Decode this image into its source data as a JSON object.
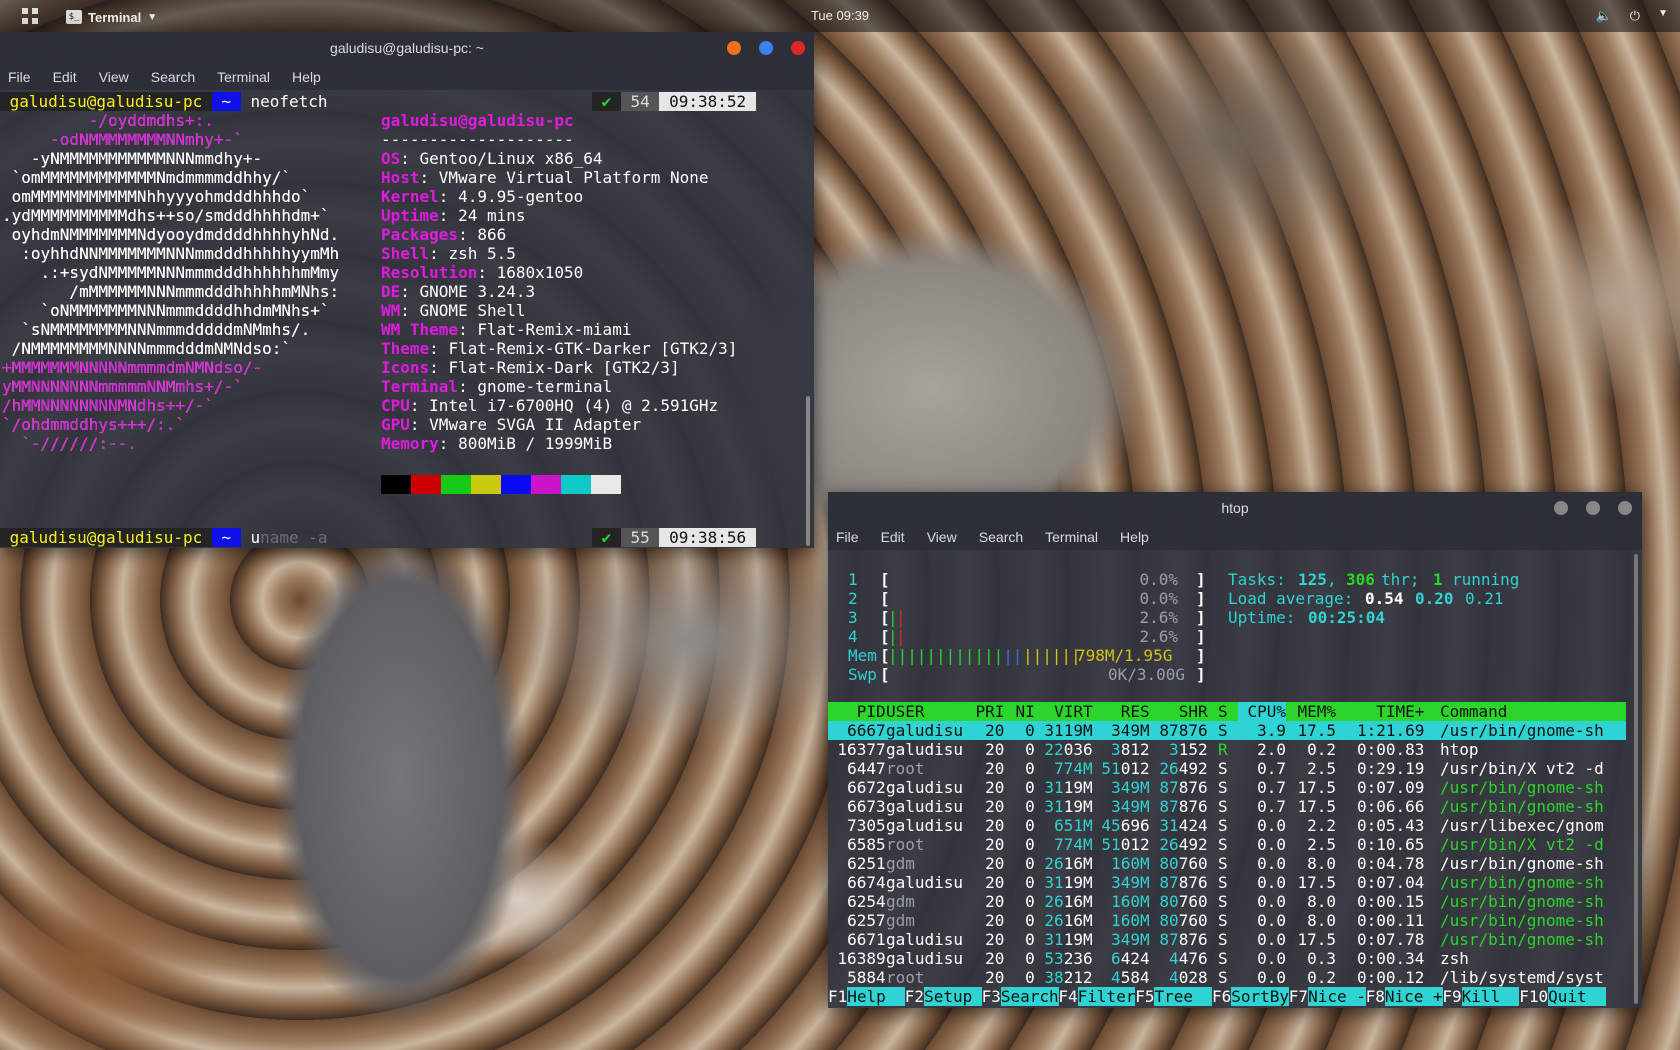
{
  "topbar": {
    "activities_icon": "grid-icon",
    "app_name": "Terminal",
    "clock": "Tue 09:39",
    "tray": [
      "speaker-icon",
      "power-icon",
      "chevron-down-icon"
    ]
  },
  "term1": {
    "title": "galudisu@galudisu-pc: ~",
    "menu": [
      "File",
      "Edit",
      "View",
      "Search",
      "Terminal",
      "Help"
    ],
    "prompt1": {
      "user": "galudisu@galudisu-pc",
      "dir": "~",
      "cmd": "neofetch",
      "check": "✔",
      "num": "54",
      "time": "09:38:52"
    },
    "prompt2": {
      "user": "galudisu@galudisu-pc",
      "dir": "~",
      "cmd_typed": "u",
      "cmd_suggest": "name -a",
      "check": "✔",
      "num": "55",
      "time": "09:38:56"
    },
    "logo": [
      "         -/oyddmdhs+:.",
      "     -odNMMMMMMMMNNmhy+-`",
      "   -yNMMMMMMMMMMMNNNmmdhy+-",
      " `omMMMMMMMMMMMMNmdmmmmddhhy/`",
      " omMMMMMMMMMMMNhhyyyohmdddhhhdo`",
      ".ydMMMMMMMMMMdhs++so/smdddhhhhdm+`",
      " oyhdmNMMMMMMMNdyooydmddddhhhhyhNd.",
      "  :oyhhdNNMMMMMMMNNNmmdddhhhhhyymMh",
      "    .:+sydNMMMMMNNNmmmdddhhhhhhmMmy",
      "       /mMMMMMMNNNmmmdddhhhhhmMNhs:",
      "    `oNMMMMMMMNNNmmmddddhhdmMNhs+`",
      "  `sNMMMMMMMMNNNmmmdddddmNMmhs/.",
      " /NMMMMMMMMNNNNmmmdddmNMNdso:`",
      "+MMMMMMMNNNNNmmmmdmNMNdso/-",
      "yMMNNNNNNNmmmmmNNMmhs+/-`",
      "/hMMNNNNNNNNMNdhs++/-`",
      "`/ohdmmddhys+++/:.`",
      "  `-//////:--."
    ],
    "info_title": "galudisu@galudisu-pc",
    "separator": "--------------------",
    "info": [
      {
        "k": "OS",
        "v": "Gentoo/Linux x86_64"
      },
      {
        "k": "Host",
        "v": "VMware Virtual Platform None"
      },
      {
        "k": "Kernel",
        "v": "4.9.95-gentoo"
      },
      {
        "k": "Uptime",
        "v": "24 mins"
      },
      {
        "k": "Packages",
        "v": "866"
      },
      {
        "k": "Shell",
        "v": "zsh 5.5"
      },
      {
        "k": "Resolution",
        "v": "1680x1050"
      },
      {
        "k": "DE",
        "v": "GNOME 3.24.3"
      },
      {
        "k": "WM",
        "v": "GNOME Shell"
      },
      {
        "k": "WM Theme",
        "v": "Flat-Remix-miami"
      },
      {
        "k": "Theme",
        "v": "Flat-Remix-GTK-Darker [GTK2/3]"
      },
      {
        "k": "Icons",
        "v": "Flat-Remix-Dark [GTK2/3]"
      },
      {
        "k": "Terminal",
        "v": "gnome-terminal"
      },
      {
        "k": "CPU",
        "v": "Intel i7-6700HQ (4) @ 2.591GHz"
      },
      {
        "k": "GPU",
        "v": "VMware SVGA II Adapter"
      },
      {
        "k": "Memory",
        "v": "800MiB / 1999MiB"
      }
    ],
    "palette": [
      "#000000",
      "#cc0000",
      "#17c917",
      "#c9c90f",
      "#0a0af0",
      "#c914c9",
      "#0fc9c9",
      "#e8e8e8"
    ]
  },
  "term2": {
    "title": "htop",
    "menu": [
      "File",
      "Edit",
      "View",
      "Search",
      "Terminal",
      "Help"
    ],
    "cpu": [
      {
        "n": "1",
        "pct": "0.0%"
      },
      {
        "n": "2",
        "pct": "0.0%"
      },
      {
        "n": "3",
        "pct": "2.6%"
      },
      {
        "n": "4",
        "pct": "2.6%"
      }
    ],
    "mem": {
      "label": "Mem",
      "value": "798M/1.95G"
    },
    "swp": {
      "label": "Swp",
      "value": "0K/3.00G"
    },
    "tasks": {
      "label": "Tasks:",
      "tasks": "125",
      "thr": "306",
      "thr_label": "thr;",
      "running": "1",
      "running_label": "running"
    },
    "load": {
      "label": "Load average:",
      "a": "0.54",
      "b": "0.20",
      "c": "0.21"
    },
    "uptime": {
      "label": "Uptime:",
      "value": "00:25:04"
    },
    "headers": [
      "PID",
      "USER",
      "PRI",
      "NI",
      "VIRT",
      "RES",
      "SHR",
      "S",
      "CPU%",
      "MEM%",
      "TIME+",
      "Command"
    ],
    "rows": [
      [
        "6667",
        "galudisu",
        "20",
        "0",
        "3119M",
        "349M",
        "87876",
        "S",
        "3.9",
        "17.5",
        "1:21.69",
        "/usr/bin/gnome-sh"
      ],
      [
        "16377",
        "galudisu",
        "20",
        "0",
        "22036",
        "3812",
        "3152",
        "R",
        "2.0",
        "0.2",
        "0:00.83",
        "htop"
      ],
      [
        "6447",
        "root",
        "20",
        "0",
        "774M",
        "51012",
        "26492",
        "S",
        "0.7",
        "2.5",
        "0:29.19",
        "/usr/bin/X vt2 -d"
      ],
      [
        "6672",
        "galudisu",
        "20",
        "0",
        "3119M",
        "349M",
        "87876",
        "S",
        "0.7",
        "17.5",
        "0:07.09",
        "/usr/bin/gnome-sh"
      ],
      [
        "6673",
        "galudisu",
        "20",
        "0",
        "3119M",
        "349M",
        "87876",
        "S",
        "0.7",
        "17.5",
        "0:06.66",
        "/usr/bin/gnome-sh"
      ],
      [
        "7305",
        "galudisu",
        "20",
        "0",
        "651M",
        "45696",
        "31424",
        "S",
        "0.0",
        "2.2",
        "0:05.43",
        "/usr/libexec/gnom"
      ],
      [
        "6585",
        "root",
        "20",
        "0",
        "774M",
        "51012",
        "26492",
        "S",
        "0.0",
        "2.5",
        "0:10.65",
        "/usr/bin/X vt2 -d"
      ],
      [
        "6251",
        "gdm",
        "20",
        "0",
        "2616M",
        "160M",
        "80760",
        "S",
        "0.0",
        "8.0",
        "0:04.78",
        "/usr/bin/gnome-sh"
      ],
      [
        "6674",
        "galudisu",
        "20",
        "0",
        "3119M",
        "349M",
        "87876",
        "S",
        "0.0",
        "17.5",
        "0:07.04",
        "/usr/bin/gnome-sh"
      ],
      [
        "6254",
        "gdm",
        "20",
        "0",
        "2616M",
        "160M",
        "80760",
        "S",
        "0.0",
        "8.0",
        "0:00.15",
        "/usr/bin/gnome-sh"
      ],
      [
        "6257",
        "gdm",
        "20",
        "0",
        "2616M",
        "160M",
        "80760",
        "S",
        "0.0",
        "8.0",
        "0:00.11",
        "/usr/bin/gnome-sh"
      ],
      [
        "6671",
        "galudisu",
        "20",
        "0",
        "3119M",
        "349M",
        "87876",
        "S",
        "0.0",
        "17.5",
        "0:07.78",
        "/usr/bin/gnome-sh"
      ],
      [
        "16389",
        "galudisu",
        "20",
        "0",
        "53236",
        "6424",
        "4476",
        "S",
        "0.0",
        "0.3",
        "0:00.34",
        "zsh"
      ],
      [
        "5884",
        "root",
        "20",
        "0",
        "38212",
        "4584",
        "4028",
        "S",
        "0.0",
        "0.2",
        "0:00.12",
        "/lib/systemd/syst"
      ]
    ],
    "fkeys": [
      {
        "k": "F1",
        "l": "Help"
      },
      {
        "k": "F2",
        "l": "Setup"
      },
      {
        "k": "F3",
        "l": "Search"
      },
      {
        "k": "F4",
        "l": "Filter"
      },
      {
        "k": "F5",
        "l": "Tree"
      },
      {
        "k": "F6",
        "l": "SortBy"
      },
      {
        "k": "F7",
        "l": "Nice -"
      },
      {
        "k": "F8",
        "l": "Nice +"
      },
      {
        "k": "F9",
        "l": "Kill"
      },
      {
        "k": "F10",
        "l": "Quit"
      }
    ]
  }
}
